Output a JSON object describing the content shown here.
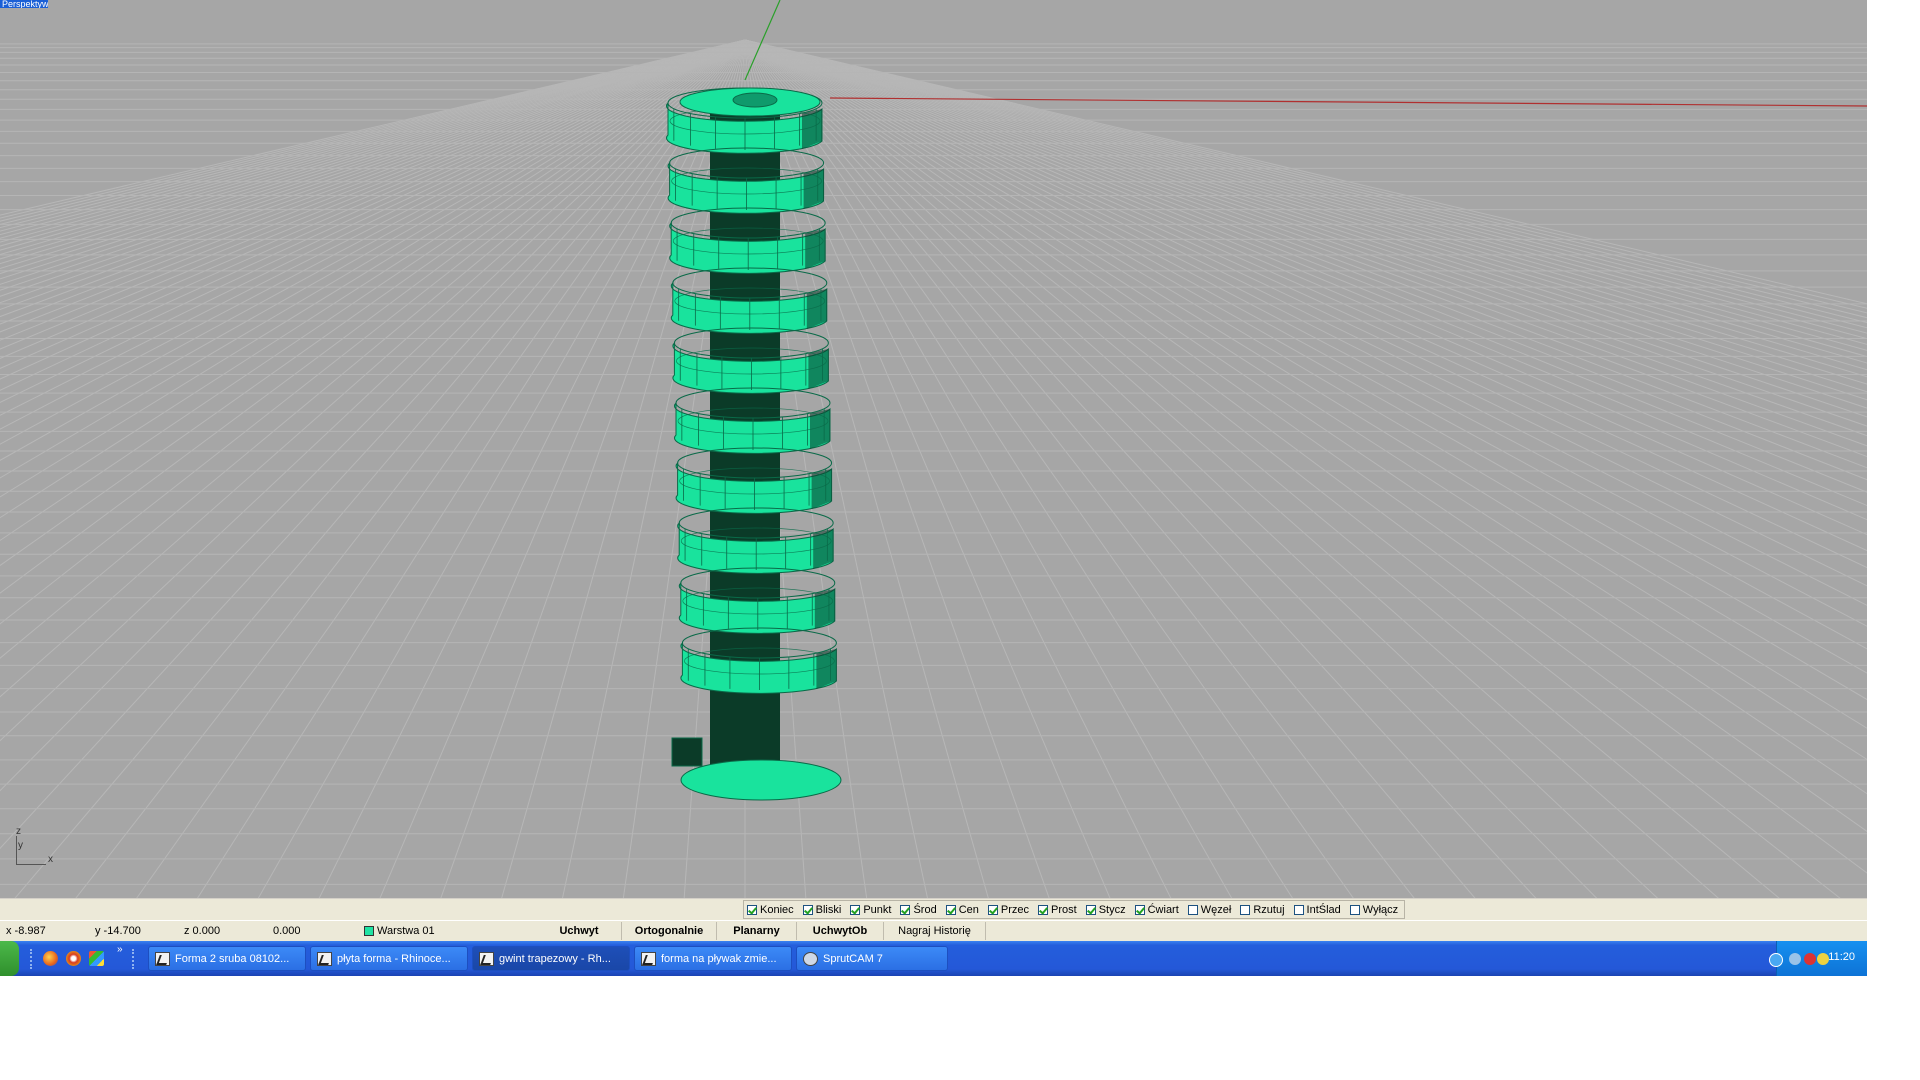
{
  "viewport": {
    "label": "Perspektywa",
    "axis_x": "x",
    "axis_y": "y",
    "axis_z": "z"
  },
  "osnaps": [
    {
      "label": "Koniec",
      "checked": true
    },
    {
      "label": "Bliski",
      "checked": true
    },
    {
      "label": "Punkt",
      "checked": true
    },
    {
      "label": "Środ",
      "checked": true
    },
    {
      "label": "Cen",
      "checked": true
    },
    {
      "label": "Przec",
      "checked": true
    },
    {
      "label": "Prost",
      "checked": true
    },
    {
      "label": "Stycz",
      "checked": true
    },
    {
      "label": "Ćwiart",
      "checked": true
    },
    {
      "label": "Węzeł",
      "checked": false
    },
    {
      "label": "Rzutuj",
      "checked": false
    },
    {
      "label": "IntŚlad",
      "checked": false
    },
    {
      "label": "Wyłącz",
      "checked": false
    }
  ],
  "status": {
    "x": "x -8.987",
    "y": "y -14.700",
    "z": "z 0.000",
    "dist": "0.000",
    "layer": "Warstwa 01",
    "buttons": [
      "Uchwyt",
      "Ortogonalnie",
      "Planarny",
      "UchwytOb",
      "Nagraj Historię"
    ]
  },
  "taskbar": {
    "tasks": [
      {
        "label": "Forma 2 sruba 08102...",
        "icon": "rhino-icon"
      },
      {
        "label": "płyta forma - Rhinoce...",
        "icon": "rhino-icon"
      },
      {
        "label": "gwint trapezowy - Rh...",
        "icon": "rhino-icon"
      },
      {
        "label": "forma na pływak zmie...",
        "icon": "rhino-icon"
      },
      {
        "label": "SprutCAM 7",
        "icon": "sprutcam-icon"
      }
    ],
    "clock": "11:20"
  },
  "colors": {
    "grid_bg": "#a6a6a6",
    "model": "#19e39d",
    "x_axis": "#b03030",
    "y_axis": "#2aa02a"
  }
}
